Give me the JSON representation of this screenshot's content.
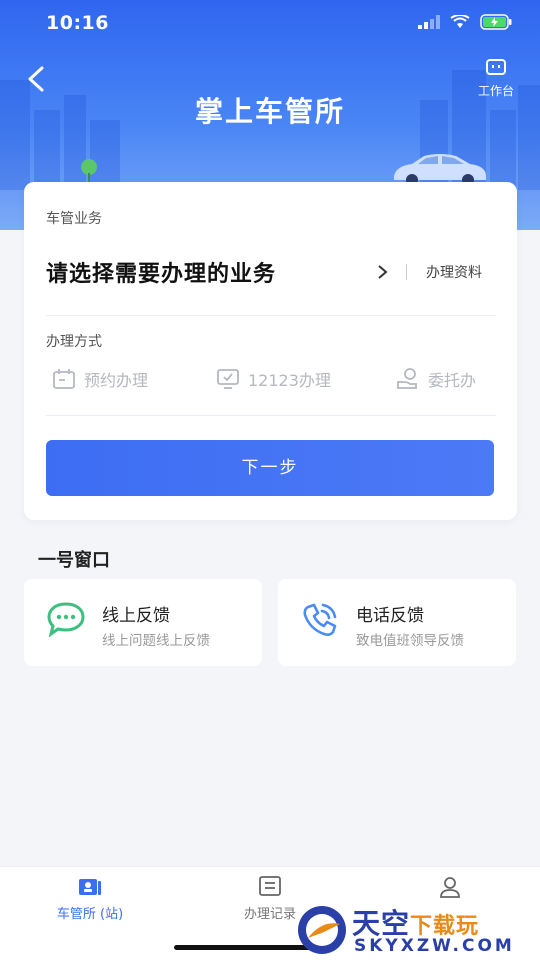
{
  "status_bar": {
    "time": "10:16"
  },
  "header": {
    "title": "掌上车管所",
    "workbench_label": "工作台"
  },
  "card": {
    "business_label": "车管业务",
    "service_placeholder": "请选择需要办理的业务",
    "materials_link": "办理资料",
    "method_label": "办理方式",
    "methods": [
      {
        "label": "预约办理",
        "icon": "calendar-icon"
      },
      {
        "label": "12123办理",
        "icon": "monitor-check-icon"
      },
      {
        "label": "委托办",
        "icon": "hand-coin-icon"
      }
    ],
    "next_button": "下一步"
  },
  "first_window": {
    "title": "一号窗口",
    "items": [
      {
        "title": "线上反馈",
        "subtitle": "线上问题线上反馈",
        "icon": "chat-bubble-icon",
        "color": "#3fbf7f"
      },
      {
        "title": "电话反馈",
        "subtitle": "致电值班领导反馈",
        "icon": "phone-call-icon",
        "color": "#4a8cf6"
      }
    ]
  },
  "tabbar": {
    "tabs": [
      {
        "label": "车管所 (站)",
        "icon": "station-icon",
        "active": true
      },
      {
        "label": "办理记录",
        "icon": "record-icon",
        "active": false
      },
      {
        "label": "",
        "icon": "user-icon",
        "active": false
      }
    ]
  },
  "watermark": {
    "title_main": "天空",
    "title_accent": "下载玩",
    "url": "SKYXZW.COM"
  },
  "colors": {
    "primary": "#3d6df3",
    "header_top": "#2f66f0",
    "green": "#3fbf7f"
  }
}
